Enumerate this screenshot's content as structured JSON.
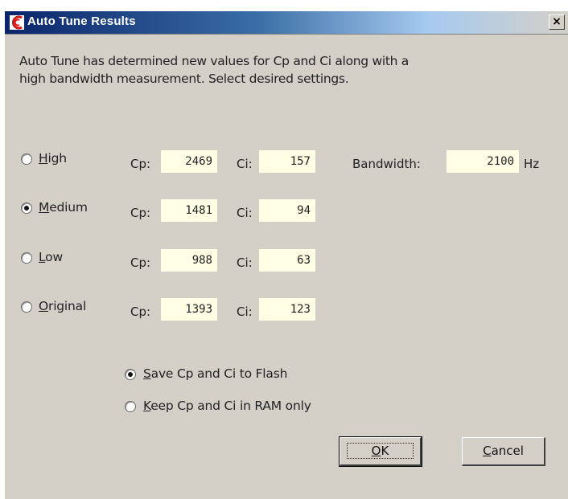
{
  "window": {
    "title": "Auto Tune Results",
    "close_label": "×"
  },
  "intro": {
    "line1": "Auto Tune has determined new values for Cp and Ci along with a",
    "line2": "high bandwidth measurement. Select desired settings."
  },
  "settings": {
    "selected": "Medium",
    "rows": [
      {
        "label_mnemonic": "H",
        "label_rest": "igh",
        "cp_label": "Cp:",
        "cp": "2469",
        "ci_label": "Ci:",
        "ci": "157",
        "checked": false
      },
      {
        "label_mnemonic": "M",
        "label_rest": "edium",
        "cp_label": "Cp:",
        "cp": "1481",
        "ci_label": "Ci:",
        "ci": "94",
        "checked": true
      },
      {
        "label_mnemonic": "L",
        "label_rest": "ow",
        "cp_label": "Cp:",
        "cp": "988",
        "ci_label": "Ci:",
        "ci": "63",
        "checked": false
      },
      {
        "label_mnemonic": "O",
        "label_rest": "riginal",
        "cp_label": "Cp:",
        "cp": "1393",
        "ci_label": "Ci:",
        "ci": "123",
        "checked": false
      }
    ]
  },
  "bandwidth": {
    "label": "Bandwidth:",
    "value": "2100",
    "unit": "Hz"
  },
  "storage": {
    "save_mnemonic": "S",
    "save_rest": "ave Cp and Ci to Flash",
    "keep_mnemonic": "K",
    "keep_rest": "eep Cp and Ci in RAM only",
    "selected": "save"
  },
  "buttons": {
    "ok_mnemonic": "O",
    "ok_rest": "K",
    "cancel_mnemonic": "C",
    "cancel_rest": "ancel"
  },
  "colors": {
    "dialog_bg": "#d4d0c8",
    "field_bg": "#ffffe6",
    "title_start": "#0a246a"
  }
}
